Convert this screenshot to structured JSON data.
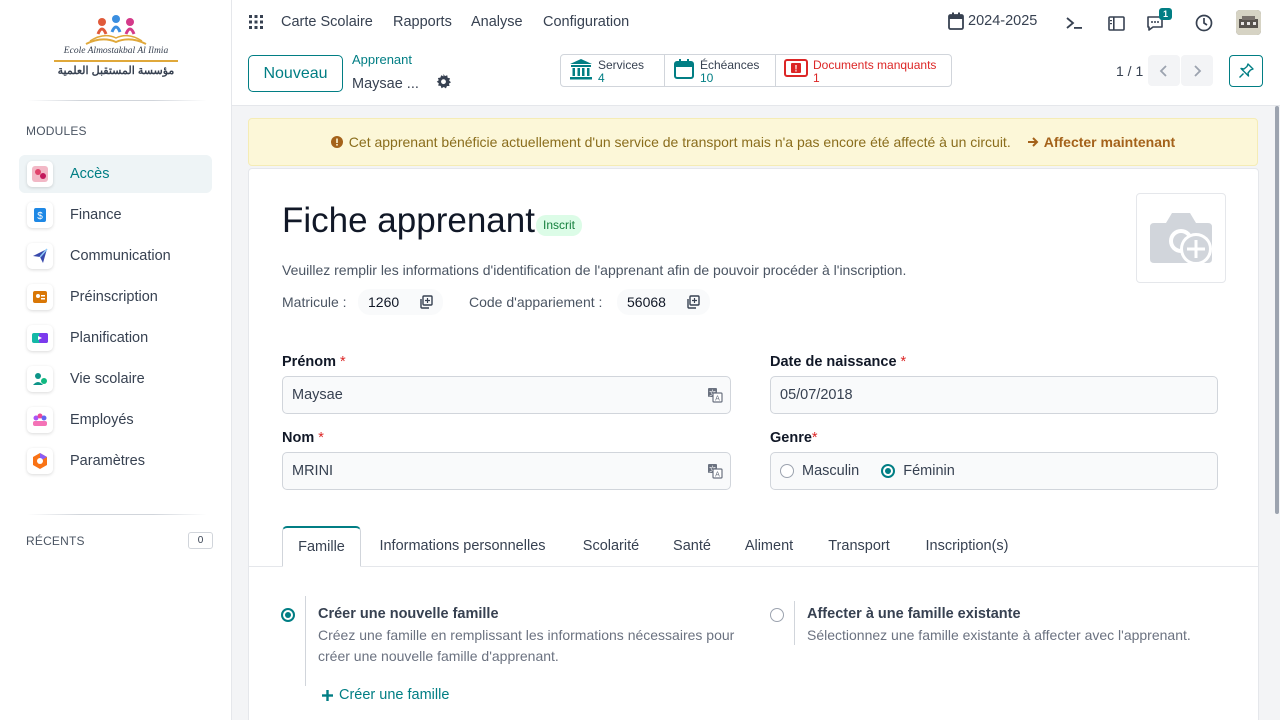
{
  "school": {
    "name_latin": "Ecole Almostakbal Al Ilmia",
    "name_arabic": "مؤسسة المستقبل العلمية"
  },
  "sidebar": {
    "modules_title": "MODULES",
    "items": [
      {
        "label": "Accès",
        "icon": "access-icon",
        "active": true
      },
      {
        "label": "Finance",
        "icon": "finance-icon"
      },
      {
        "label": "Communication",
        "icon": "communication-icon"
      },
      {
        "label": "Préinscription",
        "icon": "preinscription-icon"
      },
      {
        "label": "Planification",
        "icon": "planification-icon"
      },
      {
        "label": "Vie scolaire",
        "icon": "vie-scolaire-icon"
      },
      {
        "label": "Employés",
        "icon": "employees-icon"
      },
      {
        "label": "Paramètres",
        "icon": "settings-icon"
      }
    ],
    "recents_title": "RÉCENTS",
    "recents_count": "0"
  },
  "topbar": {
    "menu": [
      "Carte Scolaire",
      "Rapports",
      "Analyse",
      "Configuration"
    ],
    "year": "2024-2025",
    "notif_count": "1"
  },
  "control": {
    "new_label": "Nouveau",
    "breadcrumb_parent": "Apprenant",
    "breadcrumb_current": "Maysae ...",
    "smart_buttons": [
      {
        "label": "Services",
        "value": "4",
        "icon": "bank-icon"
      },
      {
        "label": "Échéances",
        "value": "10",
        "icon": "calendar-icon"
      },
      {
        "label": "Documents manquants",
        "value": "1",
        "icon": "missing-documents-icon",
        "danger": true
      }
    ],
    "pager": "1 / 1"
  },
  "alert": {
    "text": "Cet apprenant bénéficie actuellement d'un service de transport mais n'a pas encore été affecté à un circuit.",
    "action": "Affecter maintenant"
  },
  "form": {
    "title": "Fiche apprenant",
    "status": "Inscrit",
    "intro": "Veuillez remplir les informations d'identification de l'apprenant afin de pouvoir procéder à l'inscription.",
    "matricule_label": "Matricule :",
    "matricule": "1260",
    "code_label": "Code d'appariement :",
    "code": "56068",
    "prenom_label": "Prénom",
    "prenom": "Maysae",
    "nom_label": "Nom",
    "nom": "MRINI",
    "dob_label": "Date de naissance",
    "dob": "05/07/2018",
    "genre_label": "Genre",
    "genre_options": [
      "Masculin",
      "Féminin"
    ],
    "genre_selected": "Féminin",
    "required_mark": "*"
  },
  "tabs": [
    "Famille",
    "Informations personnelles",
    "Scolarité",
    "Santé",
    "Aliment",
    "Transport",
    "Inscription(s)"
  ],
  "famille": {
    "new_title": "Créer une nouvelle famille",
    "new_desc": "Créez une famille en remplissant les informations nécessaires pour créer une nouvelle famille d'apprenant.",
    "existing_title": "Affecter à une famille existante",
    "existing_desc": "Sélectionnez une famille existante à affecter avec l'apprenant.",
    "create_link": "Créer une famille"
  },
  "colors": {
    "accent": "#017e84",
    "danger": "#dc2626",
    "alert_bg": "#fcf7d8",
    "success_bg": "#dcfce7"
  }
}
